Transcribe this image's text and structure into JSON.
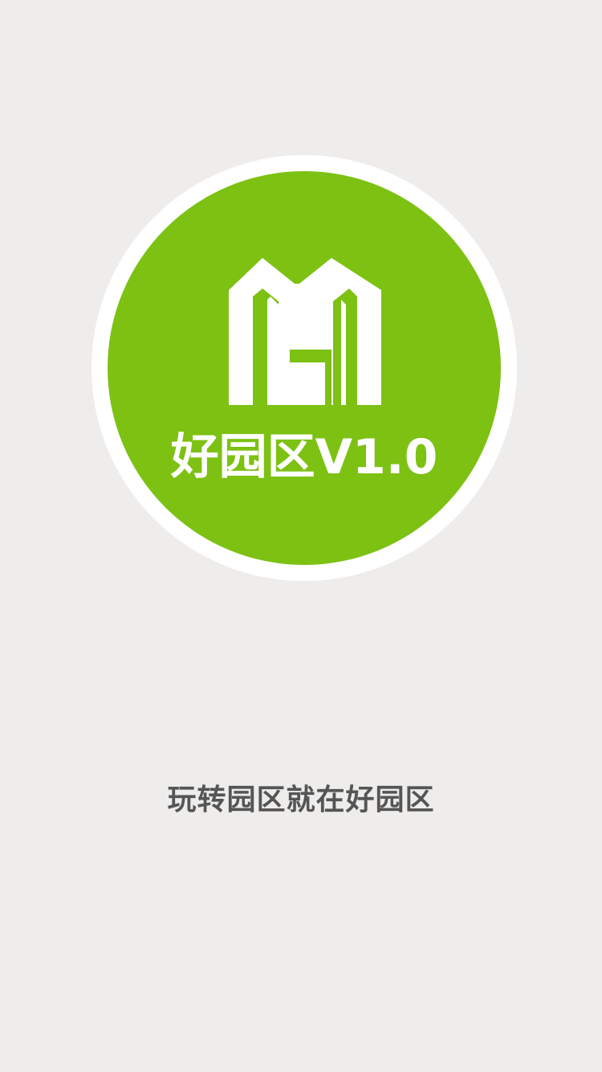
{
  "colors": {
    "background": "#eeedeb",
    "ring": "#ffffff",
    "brand_green": "#7dc113",
    "tagline_text": "#555555"
  },
  "logo": {
    "icon": "house-h-logo-icon",
    "app_name": "好园区V1.0"
  },
  "tagline": "玩转园区就在好园区"
}
